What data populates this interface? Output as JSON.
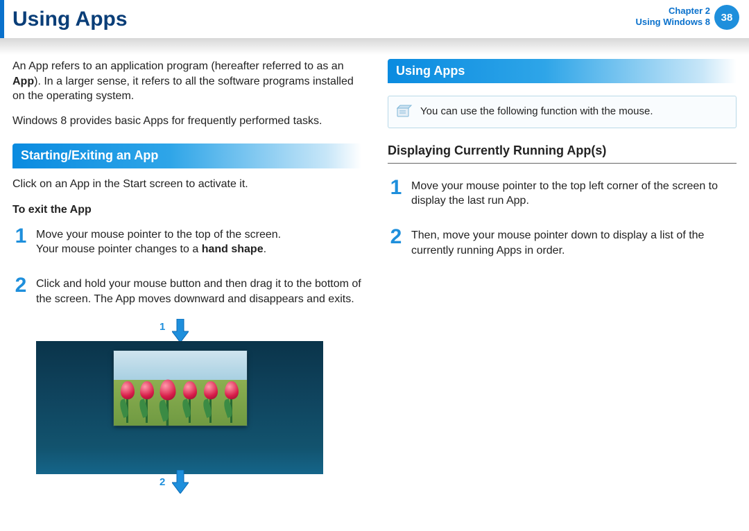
{
  "header": {
    "title": "Using Apps",
    "chapter_line1": "Chapter 2",
    "chapter_line2": "Using Windows 8",
    "page_number": "38"
  },
  "left": {
    "intro_html": "An App refers to an application program (hereafter referred to as an <b>App</b>). In a larger sense, it refers to all the software programs installed on the operating system.",
    "intro2": "Windows 8 provides basic Apps for frequently performed tasks.",
    "section1_title": "Starting/Exiting an App",
    "section1_p": "Click on an App in the Start screen to activate it.",
    "to_exit_label": "To exit the App",
    "steps": [
      {
        "n": "1",
        "html": "Move your mouse pointer to the top of the screen.<br>Your mouse pointer changes to a <b>hand shape</b>."
      },
      {
        "n": "2",
        "html": "Click and hold your mouse button and then drag it to the bottom of the screen. The App moves downward and disappears and exits."
      }
    ],
    "fig": {
      "top_label": "1",
      "bottom_label": "2"
    }
  },
  "right": {
    "section_title": "Using Apps",
    "note": "You can use the following function with the mouse.",
    "h3": "Displaying Currently Running App(s)",
    "steps": [
      {
        "n": "1",
        "html": "Move your mouse pointer to the top left corner of the screen to display the last run App."
      },
      {
        "n": "2",
        "html": "Then, move your mouse pointer down to display a list of the currently running Apps in order."
      }
    ]
  }
}
